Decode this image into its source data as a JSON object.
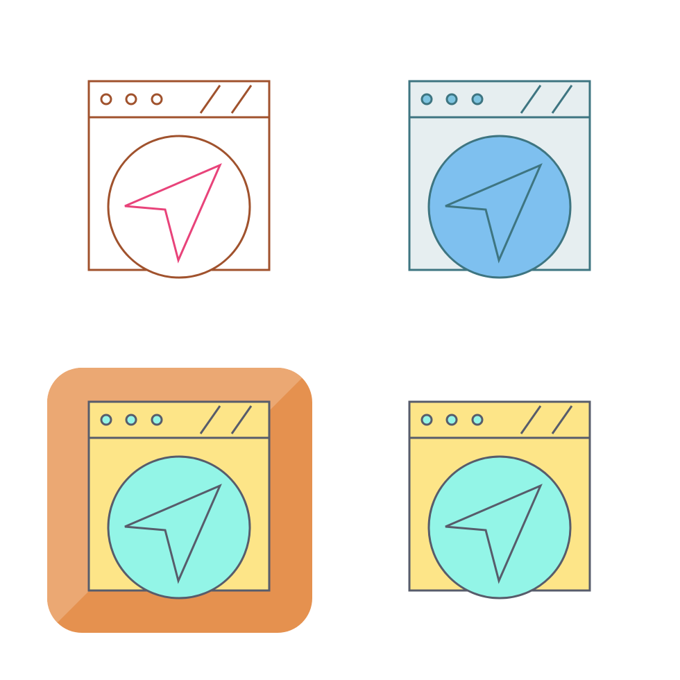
{
  "icons": [
    {
      "name": "browser-navigation-icon",
      "style": "outline",
      "colors": {
        "stroke": "#a0522d",
        "window_fill": "none",
        "bar_fill": "none",
        "circle_fill": "#ffffff",
        "arrow_stroke": "#e8437a",
        "arrow_fill": "none"
      }
    },
    {
      "name": "browser-navigation-icon",
      "style": "color-filled",
      "colors": {
        "stroke": "#3e7581",
        "window_fill": "#e6eef0",
        "bar_fill": "#e6eef0",
        "dot_fill": "#7dc4e0",
        "circle_fill": "#7ec0ef",
        "arrow_stroke": "#3e7581",
        "arrow_fill": "#7ec0ef"
      }
    },
    {
      "name": "browser-navigation-icon",
      "style": "filled-on-badge",
      "colors": {
        "badge_fill_light": "#eba873",
        "badge_fill_dark": "#e5914f",
        "stroke": "#575c6b",
        "window_fill": "#fde588",
        "bar_fill": "#fde588",
        "dot_fill": "#93f5e7",
        "circle_fill": "#93f5e7",
        "arrow_stroke": "#575c6b",
        "arrow_fill": "#93f5e7"
      }
    },
    {
      "name": "browser-navigation-icon",
      "style": "filled",
      "colors": {
        "stroke": "#575c6b",
        "window_fill": "#fde588",
        "bar_fill": "#fde588",
        "dot_fill": "#93f5e7",
        "circle_fill": "#93f5e7",
        "arrow_stroke": "#575c6b",
        "arrow_fill": "#93f5e7"
      }
    }
  ]
}
